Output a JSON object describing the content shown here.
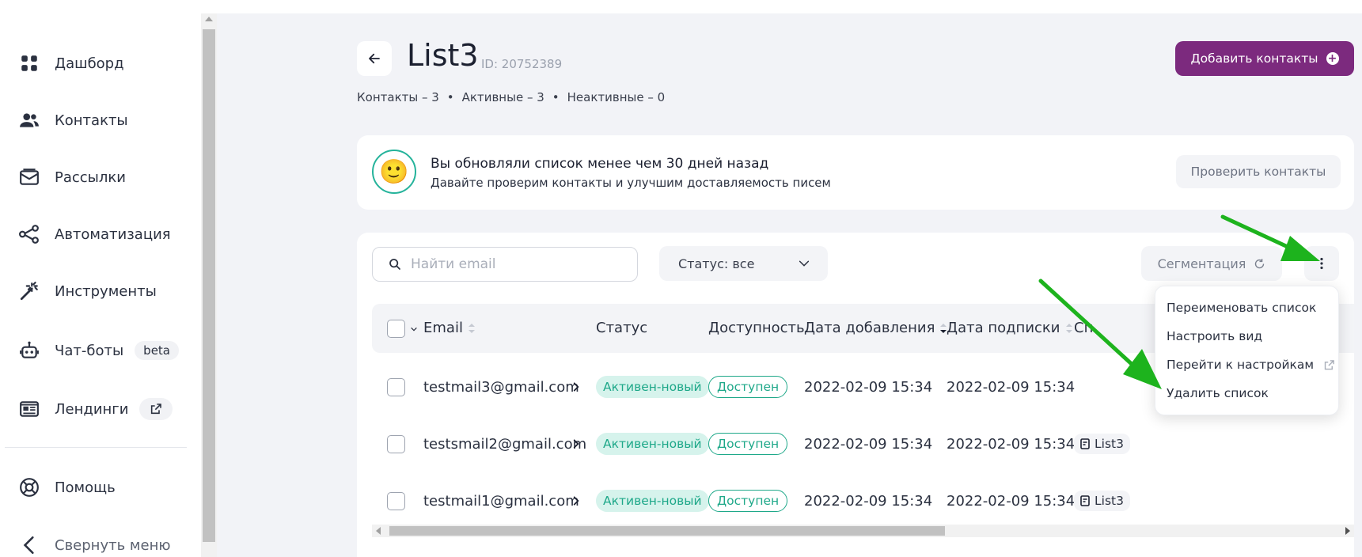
{
  "sidebar": {
    "items": [
      {
        "label": "Дашборд",
        "icon": "dashboard-icon"
      },
      {
        "label": "Контакты",
        "icon": "contacts-icon"
      },
      {
        "label": "Рассылки",
        "icon": "mail-icon"
      },
      {
        "label": "Автоматизация",
        "icon": "automation-icon"
      },
      {
        "label": "Инструменты",
        "icon": "tools-icon"
      },
      {
        "label": "Чат-боты",
        "icon": "chatbot-icon",
        "badge": "beta"
      },
      {
        "label": "Лендинги",
        "icon": "landing-icon",
        "badge_icon": "external-link-icon"
      }
    ],
    "help": "Помощь",
    "collapse": "Свернуть меню"
  },
  "header": {
    "title": "List3",
    "id_text": "ID: 20752389",
    "stats": {
      "contacts": "Контакты – 3",
      "active": "Активные – 3",
      "inactive": "Неактивные – 0"
    },
    "add_button": "Добавить контакты"
  },
  "notice": {
    "title": "Вы обновляли список менее чем 30 дней назад",
    "subtitle": "Давайте проверим контакты и улучшим доставляемость писем",
    "button": "Проверить контакты"
  },
  "toolbar": {
    "search_placeholder": "Найти email",
    "status_filter": "Статус: все",
    "segmentation": "Сегментация"
  },
  "table": {
    "columns": [
      "Email",
      "Статус",
      "Доступность",
      "Дата добавления",
      "Дата подписки",
      "Сп"
    ],
    "rows": [
      {
        "email": "testmail3@gmail.com",
        "status": "Активен-новый",
        "availability": "Доступен",
        "added": "2022-02-09 15:34",
        "subscribed": "2022-02-09 15:34",
        "list": ""
      },
      {
        "email": "testsmail2@gmail.com",
        "status": "Активен-новый",
        "availability": "Доступен",
        "added": "2022-02-09 15:34",
        "subscribed": "2022-02-09 15:34",
        "list": "List3"
      },
      {
        "email": "testmail1@gmail.com",
        "status": "Активен-новый",
        "availability": "Доступен",
        "added": "2022-02-09 15:34",
        "subscribed": "2022-02-09 15:34",
        "list": "List3"
      }
    ]
  },
  "menu": {
    "items": [
      "Переименовать список",
      "Настроить вид",
      "Перейти к настройкам",
      "Удалить список"
    ]
  },
  "colors": {
    "brand": "#7c2a7e",
    "success": "#1ea889",
    "annotation_arrow": "#1db31d"
  }
}
